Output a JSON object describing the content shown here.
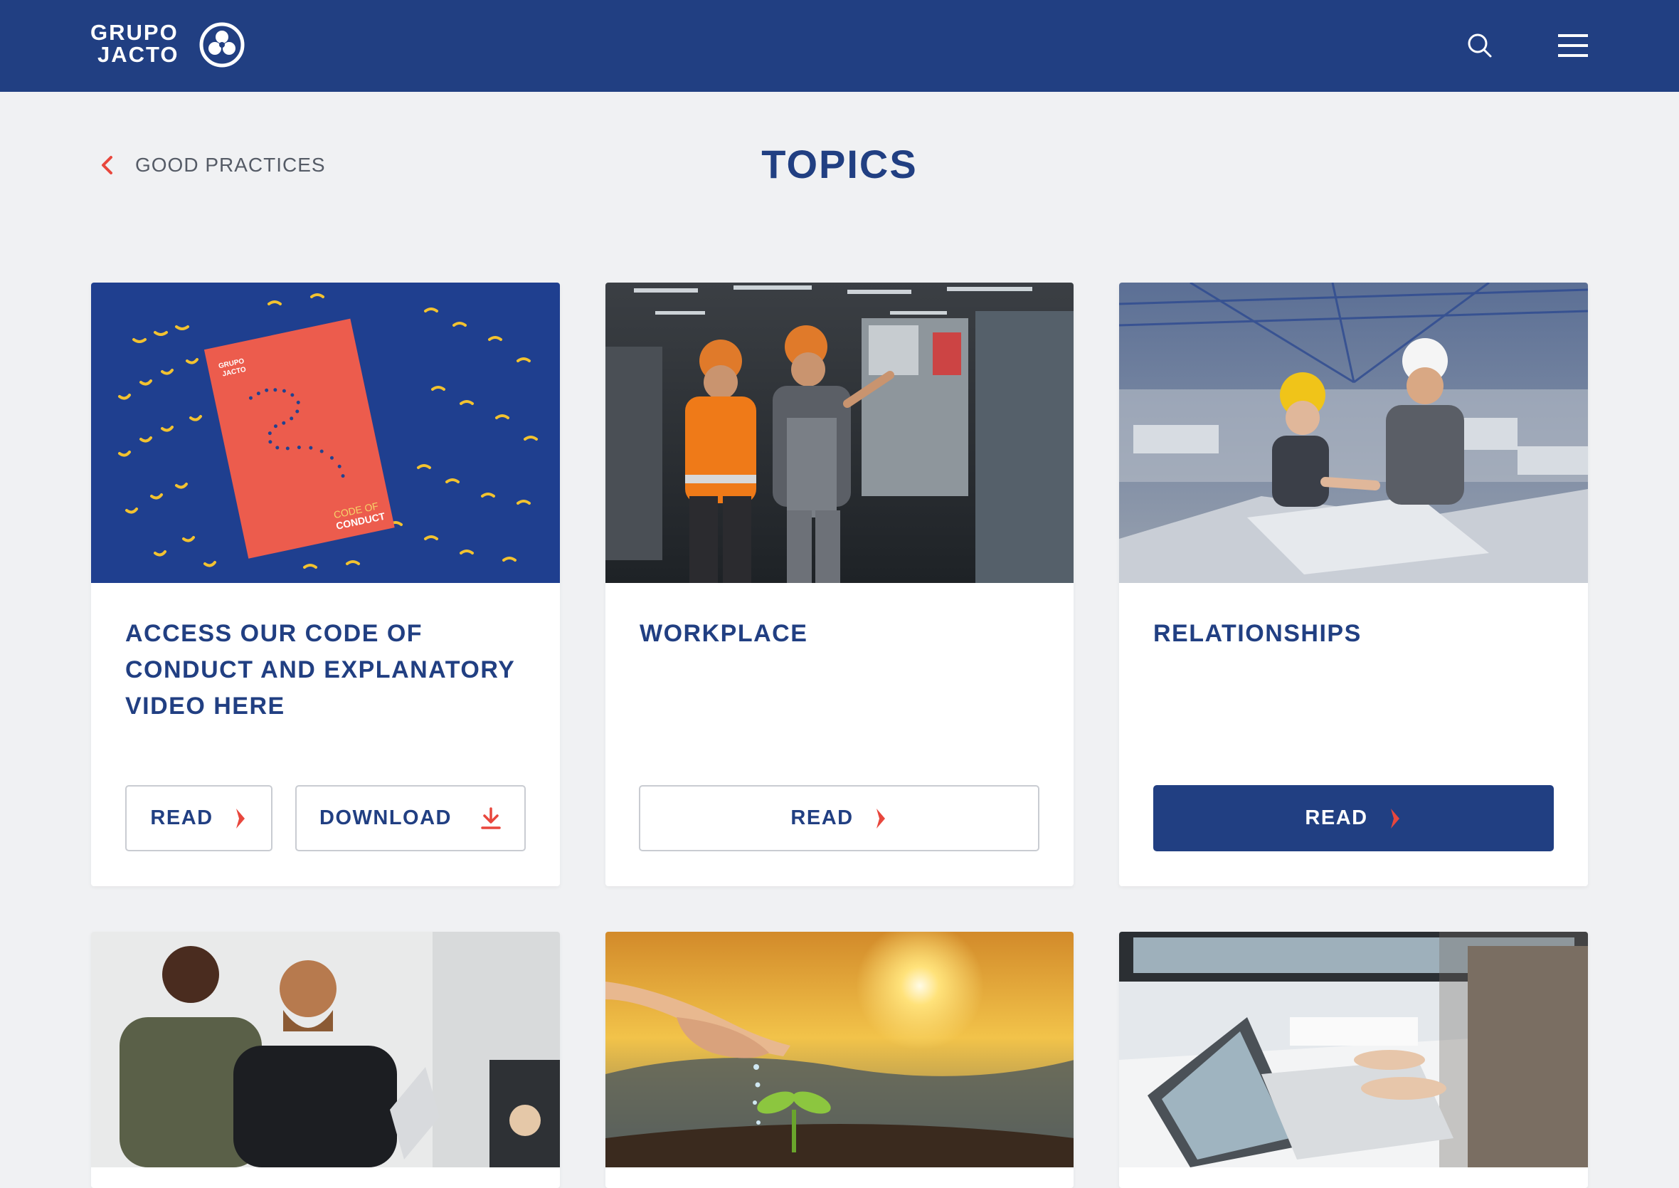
{
  "header": {
    "logo_line1": "GRUPO",
    "logo_line2": "JACTO",
    "search_icon": "search-icon",
    "menu_icon": "hamburger-menu-icon"
  },
  "breadcrumb": {
    "back_label": "GOOD PRACTICES"
  },
  "page": {
    "title": "TOPICS"
  },
  "colors": {
    "brand_blue": "#213f82",
    "accent_red": "#e8473d",
    "background": "#f0f1f3"
  },
  "cards": [
    {
      "title": "ACCESS OUR CODE OF CONDUCT AND EXPLANATORY VIDEO HERE",
      "image": "code-of-conduct-booklet",
      "image_text_brand_1": "GRUPO",
      "image_text_brand_2": "JACTO",
      "image_text_1": "CODE OF",
      "image_text_2": "CONDUCT",
      "read_label": "READ",
      "download_label": "DOWNLOAD"
    },
    {
      "title": "WORKPLACE",
      "image": "factory-workers-hardhats",
      "read_label": "READ"
    },
    {
      "title": "RELATIONSHIPS",
      "image": "handshake-in-factory",
      "read_label": "READ"
    },
    {
      "image": "colleagues-talking-laptop"
    },
    {
      "image": "watering-seedling-sunset"
    },
    {
      "image": "office-laptop-desk"
    }
  ]
}
